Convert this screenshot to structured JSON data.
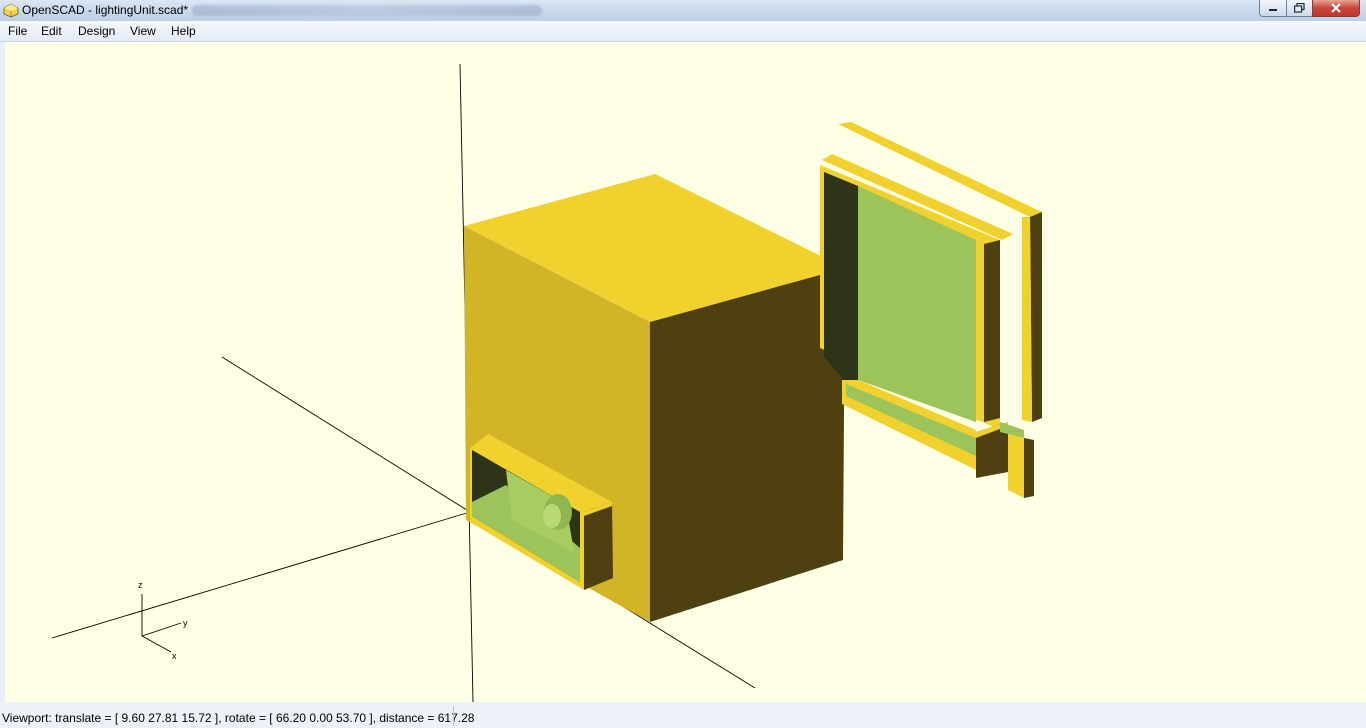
{
  "window": {
    "title": "OpenSCAD - lightingUnit.scad*",
    "icon": "openscad-icon",
    "controls": {
      "minimize": "minimize-icon",
      "maximize": "maximize-icon",
      "close": "close-icon"
    }
  },
  "menu": {
    "file": "File",
    "edit": "Edit",
    "design": "Design",
    "view": "View",
    "help": "Help"
  },
  "viewport": {
    "background_color": "#ffffe5",
    "model_face_color": "#f9d72c",
    "model_back_color": "#9dc45a",
    "axes_labels": {
      "x": "x",
      "y": "y",
      "z": "z"
    }
  },
  "status": {
    "text": "Viewport: translate = [ 9.60 27.81 15.72 ], rotate = [ 66.20 0.00 53.70 ], distance = 617.28"
  }
}
